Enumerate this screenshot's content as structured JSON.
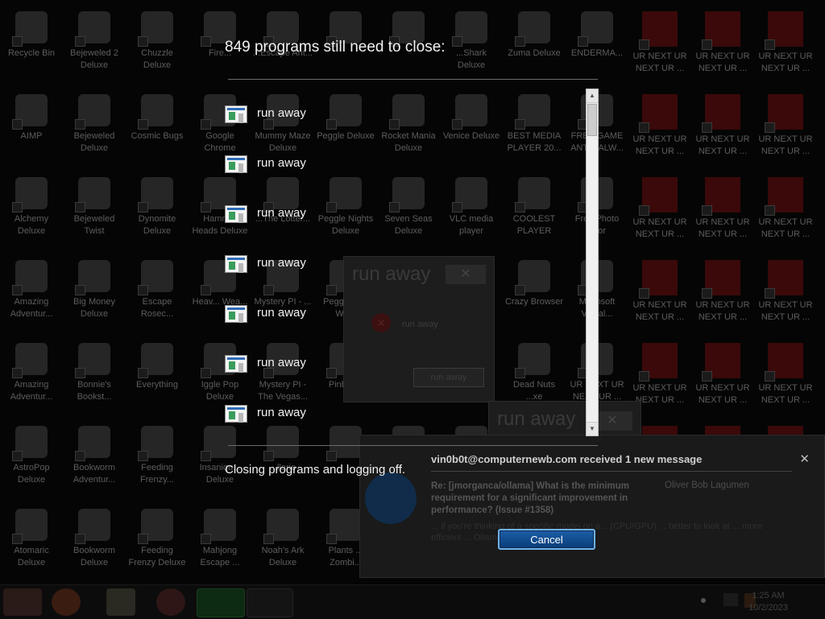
{
  "shutdown_dialog": {
    "title": "849 programs still need to close:",
    "status": "Closing programs and logging off.",
    "cancel_label": "Cancel",
    "programs": [
      {
        "name": "run away",
        "icon": "window-app-icon"
      },
      {
        "name": "run away",
        "icon": "window-app-icon"
      },
      {
        "name": "run away",
        "icon": "window-app-icon"
      },
      {
        "name": "run away",
        "icon": "window-app-icon"
      },
      {
        "name": "run away",
        "icon": "window-app-icon"
      },
      {
        "name": "run away",
        "icon": "window-app-icon"
      },
      {
        "name": "run away",
        "icon": "window-app-icon"
      }
    ]
  },
  "background_dialogs": [
    {
      "title": "run away",
      "message": "run away",
      "button": "run away",
      "close": "✕"
    },
    {
      "title": "run away",
      "close": "✕"
    }
  ],
  "notification": {
    "header": "vin0b0t@computernewb.com received 1 new message",
    "subject": "Re: [jmorganca/ollama] What is the minimum requirement for a significant improvement in performance? (Issue #1358)",
    "sender": "Oliver Bob Lagumen",
    "body": "... if you're thinking of a specific model on a... (CPU/GPU) ... better to look at ... more efficient ... Ollama ... running ...",
    "close": "✕"
  },
  "desktop_icons": [
    {
      "label": "Recycle Bin"
    },
    {
      "label": "Bejeweled 2 Deluxe"
    },
    {
      "label": "Chuzzle Deluxe"
    },
    {
      "label": "Fire..."
    },
    {
      "label": "...Escape Ant..."
    },
    {
      "label": ""
    },
    {
      "label": ""
    },
    {
      "label": "...Shark Deluxe"
    },
    {
      "label": "Zuma Deluxe"
    },
    {
      "label": "ENDERMA..."
    },
    {
      "label": "UR NEXT UR NEXT UR ..."
    },
    {
      "label": "UR NEXT UR NEXT UR ..."
    },
    {
      "label": "UR NEXT UR NEXT UR ..."
    },
    {
      "label": "AIMP"
    },
    {
      "label": "Bejeweled Deluxe"
    },
    {
      "label": "Cosmic Bugs"
    },
    {
      "label": "Google Chrome"
    },
    {
      "label": "Mummy Maze Deluxe"
    },
    {
      "label": "Peggle Deluxe"
    },
    {
      "label": "Rocket Mania Deluxe"
    },
    {
      "label": "Venice Deluxe"
    },
    {
      "label": "BEST MEDIA PLAYER 20..."
    },
    {
      "label": "FREE GAME ANTIMALW..."
    },
    {
      "label": "UR NEXT UR NEXT UR ..."
    },
    {
      "label": "UR NEXT UR NEXT UR ..."
    },
    {
      "label": "UR NEXT UR NEXT UR ..."
    },
    {
      "label": "Alchemy Deluxe"
    },
    {
      "label": "Bejeweled Twist"
    },
    {
      "label": "Dynomite Deluxe"
    },
    {
      "label": "Hamm... Heads Deluxe"
    },
    {
      "label": "...The Lotter..."
    },
    {
      "label": "Peggle Nights Deluxe"
    },
    {
      "label": "Seven Seas Deluxe"
    },
    {
      "label": "VLC media player"
    },
    {
      "label": "COOLEST PLAYER"
    },
    {
      "label": "Free Photo ...tor"
    },
    {
      "label": "UR NEXT UR NEXT UR ..."
    },
    {
      "label": "UR NEXT UR NEXT UR ..."
    },
    {
      "label": "UR NEXT UR NEXT UR ..."
    },
    {
      "label": "Amazing Adventur..."
    },
    {
      "label": "Big Money Deluxe"
    },
    {
      "label": "Escape Rosec..."
    },
    {
      "label": "Heav... Wea..."
    },
    {
      "label": "Mystery PI - ..."
    },
    {
      "label": "Peggle ...of Wa..."
    },
    {
      "label": ""
    },
    {
      "label": ""
    },
    {
      "label": "Crazy Browser"
    },
    {
      "label": "Microsoft Visual..."
    },
    {
      "label": "UR NEXT UR NEXT UR ..."
    },
    {
      "label": "UR NEXT UR NEXT UR ..."
    },
    {
      "label": "UR NEXT UR NEXT UR ..."
    },
    {
      "label": "Amazing Adventur..."
    },
    {
      "label": "Bonnie's Bookst..."
    },
    {
      "label": "Everything"
    },
    {
      "label": "Iggle Pop Deluxe"
    },
    {
      "label": "Mystery PI - The Vegas..."
    },
    {
      "label": "Pinball..."
    },
    {
      "label": ""
    },
    {
      "label": ""
    },
    {
      "label": "Dead Nuts ...xe"
    },
    {
      "label": "UR NEXT UR NEXT UR ..."
    },
    {
      "label": "UR NEXT UR NEXT UR ..."
    },
    {
      "label": "UR NEXT UR NEXT UR ..."
    },
    {
      "label": "UR NEXT UR NEXT UR ..."
    },
    {
      "label": "AstroPop Deluxe"
    },
    {
      "label": "Bookworm Adventur..."
    },
    {
      "label": "Feeding Frenzy..."
    },
    {
      "label": "Insaniqu... Deluxe"
    },
    {
      "label": "...llarie"
    },
    {
      "label": ""
    },
    {
      "label": ""
    },
    {
      "label": ""
    },
    {
      "label": ""
    },
    {
      "label": ""
    },
    {
      "label": ""
    },
    {
      "label": ""
    },
    {
      "label": ""
    },
    {
      "label": "Atomaric Deluxe"
    },
    {
      "label": "Bookworm Deluxe"
    },
    {
      "label": "Feeding Frenzy Deluxe"
    },
    {
      "label": "Mahjong Escape ..."
    },
    {
      "label": "Noah's Ark Deluxe"
    },
    {
      "label": "Plants ... Zombi..."
    },
    {
      "label": ""
    },
    {
      "label": ""
    },
    {
      "label": ""
    },
    {
      "label": ""
    },
    {
      "label": ""
    },
    {
      "label": ""
    },
    {
      "label": ""
    }
  ],
  "taskbar": {
    "time": "1:25 AM",
    "date": "10/2/2023",
    "buttons": [
      "start-button",
      "firefox-icon",
      "file-explorer-icon",
      "chrome-icon",
      "task-manager-icon",
      "calendar-icon"
    ]
  },
  "colors": {
    "accent": "#1c5fa8",
    "background": "#050505",
    "text": "#f2f2f2"
  }
}
